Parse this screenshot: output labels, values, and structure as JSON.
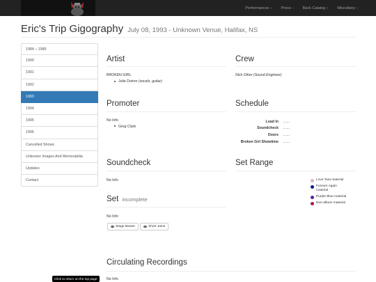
{
  "nav": {
    "items": [
      {
        "label": "Performances"
      },
      {
        "label": "Press"
      },
      {
        "label": "Back Catalog"
      },
      {
        "label": "Miscellany"
      }
    ]
  },
  "header": {
    "title": "Eric's Trip Gigography",
    "subtitle": "July 08, 1993 - Unknown Venue, Halifax, NS"
  },
  "sidebar": {
    "items": [
      {
        "label": "1984 – 1989"
      },
      {
        "label": "1990"
      },
      {
        "label": "1991"
      },
      {
        "label": "1992"
      },
      {
        "label": "1993",
        "active": true
      },
      {
        "label": "1994"
      },
      {
        "label": "1995"
      },
      {
        "label": "1996"
      },
      {
        "label": "Cancelled Shows"
      },
      {
        "label": "Unknown Images And Memorabilia"
      },
      {
        "label": "Updates"
      },
      {
        "label": "Contact"
      }
    ]
  },
  "artist": {
    "title": "Artist",
    "band": "BROKEN GIRL",
    "member_name": "Julie Doiron",
    "member_role": "(vocals, guitar)"
  },
  "crew": {
    "title": "Crew",
    "name": "Nick Other",
    "role": "(Sound Engineer)"
  },
  "promoter": {
    "title": "Promoter",
    "info": "No Info",
    "name": "Greg Clark"
  },
  "schedule": {
    "title": "Schedule",
    "rows": [
      {
        "key": "Load In",
        "value": "……"
      },
      {
        "key": "Soundcheck",
        "value": "……"
      },
      {
        "key": "Doors",
        "value": "……"
      },
      {
        "key": "Broken Girl Showtime",
        "value": "……"
      }
    ]
  },
  "soundcheck": {
    "title": "Soundcheck",
    "info": "No Info"
  },
  "set_range": {
    "title": "Set Range",
    "legend": [
      {
        "label": "Love Tara material",
        "color": "#d7b7c4"
      },
      {
        "label": "Forever Again material",
        "color": "#0b1a8a"
      },
      {
        "label": "Purple Blue material",
        "color": "#5a1fa0"
      },
      {
        "label": "Non-album material",
        "color": "#b0174a"
      }
    ]
  },
  "set": {
    "title": "Set",
    "status": "incomplete",
    "info": "No Info",
    "buttons": [
      {
        "label": "Stage Banter"
      },
      {
        "label": "Short Jams"
      }
    ]
  },
  "recordings": {
    "title": "Circulating Recordings",
    "info": "No Info"
  },
  "footer": {
    "top_link": "Click to return on the top page"
  }
}
